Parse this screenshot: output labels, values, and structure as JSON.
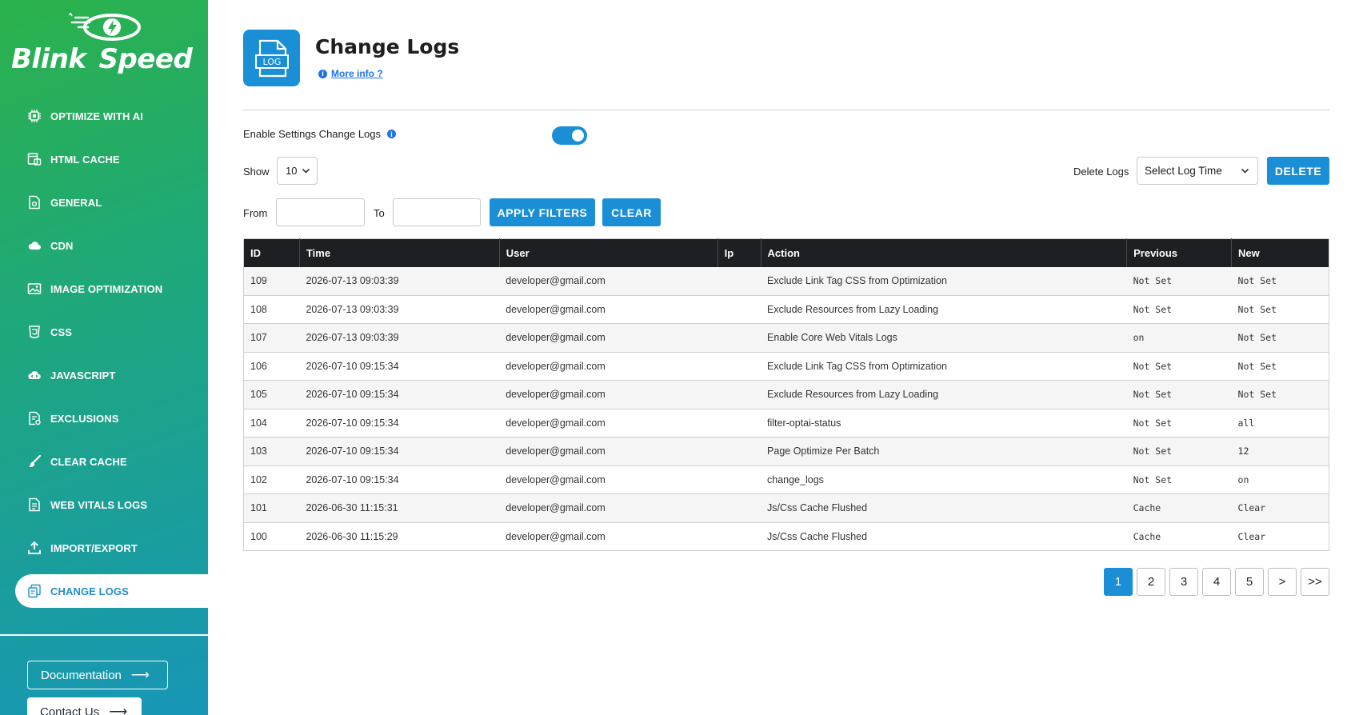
{
  "brand": {
    "name_part1": "Blink",
    "name_part2": "Speed"
  },
  "sidebar": {
    "items": [
      {
        "label": "OPTIMIZE WITH AI",
        "icon": "chip-icon"
      },
      {
        "label": "HTML CACHE",
        "icon": "html-cache-icon"
      },
      {
        "label": "GENERAL",
        "icon": "settings-doc-icon"
      },
      {
        "label": "CDN",
        "icon": "cloud-icon"
      },
      {
        "label": "IMAGE OPTIMIZATION",
        "icon": "image-icon"
      },
      {
        "label": "CSS",
        "icon": "css-icon"
      },
      {
        "label": "JAVASCRIPT",
        "icon": "js-icon"
      },
      {
        "label": "EXCLUSIONS",
        "icon": "exclusions-icon"
      },
      {
        "label": "CLEAR CACHE",
        "icon": "brush-icon"
      },
      {
        "label": "WEB VITALS LOGS",
        "icon": "vitals-doc-icon"
      },
      {
        "label": "IMPORT/EXPORT",
        "icon": "upload-icon"
      },
      {
        "label": "CHANGE LOGS",
        "icon": "change-logs-icon",
        "active": true
      }
    ],
    "documentation_label": "Documentation",
    "contact_label": "Contact Us"
  },
  "header": {
    "icon_text": "LOG",
    "title": "Change Logs",
    "more_info": "More info ?"
  },
  "controls": {
    "enable_label": "Enable Settings Change Logs",
    "enable_on": true,
    "show_label": "Show",
    "show_value": "10",
    "delete_label": "Delete Logs",
    "log_time_placeholder": "Select Log Time",
    "delete_button": "DELETE",
    "from_label": "From",
    "to_label": "To",
    "from_value": "",
    "to_value": "",
    "apply_button": "APPLY FILTERS",
    "clear_button": "CLEAR"
  },
  "table": {
    "columns": [
      "ID",
      "Time",
      "User",
      "Ip",
      "Action",
      "Previous",
      "New"
    ],
    "rows": [
      [
        "109",
        "2026-07-13 09:03:39",
        "developer@gmail.com",
        "",
        "Exclude Link Tag CSS from Optimization",
        "Not Set",
        "Not Set"
      ],
      [
        "108",
        "2026-07-13 09:03:39",
        "developer@gmail.com",
        "",
        "Exclude Resources from Lazy Loading",
        "Not Set",
        "Not Set"
      ],
      [
        "107",
        "2026-07-13 09:03:39",
        "developer@gmail.com",
        "",
        "Enable Core Web Vitals Logs",
        "on",
        "Not Set"
      ],
      [
        "106",
        "2026-07-10 09:15:34",
        "developer@gmail.com",
        "",
        "Exclude Link Tag CSS from Optimization",
        "Not Set",
        "Not Set"
      ],
      [
        "105",
        "2026-07-10 09:15:34",
        "developer@gmail.com",
        "",
        "Exclude Resources from Lazy Loading",
        "Not Set",
        "Not Set"
      ],
      [
        "104",
        "2026-07-10 09:15:34",
        "developer@gmail.com",
        "",
        "filter-optai-status",
        "Not Set",
        "all"
      ],
      [
        "103",
        "2026-07-10 09:15:34",
        "developer@gmail.com",
        "",
        "Page Optimize Per Batch",
        "Not Set",
        "12"
      ],
      [
        "102",
        "2026-07-10 09:15:34",
        "developer@gmail.com",
        "",
        "change_logs",
        "Not Set",
        "on"
      ],
      [
        "101",
        "2026-06-30 11:15:31",
        "developer@gmail.com",
        "",
        "Js/Css Cache Flushed",
        "Cache",
        "Clear"
      ],
      [
        "100",
        "2026-06-30 11:15:29",
        "developer@gmail.com",
        "",
        "Js/Css Cache Flushed",
        "Cache",
        "Clear"
      ]
    ]
  },
  "pagination": {
    "pages": [
      "1",
      "2",
      "3",
      "4",
      "5"
    ],
    "current": "1",
    "next": ">",
    "last": ">>"
  },
  "colors": {
    "accent": "#1a8fd6",
    "sidebar_top": "#2bb24a",
    "sidebar_bottom": "#1796b8",
    "table_header": "#1d1f22"
  }
}
